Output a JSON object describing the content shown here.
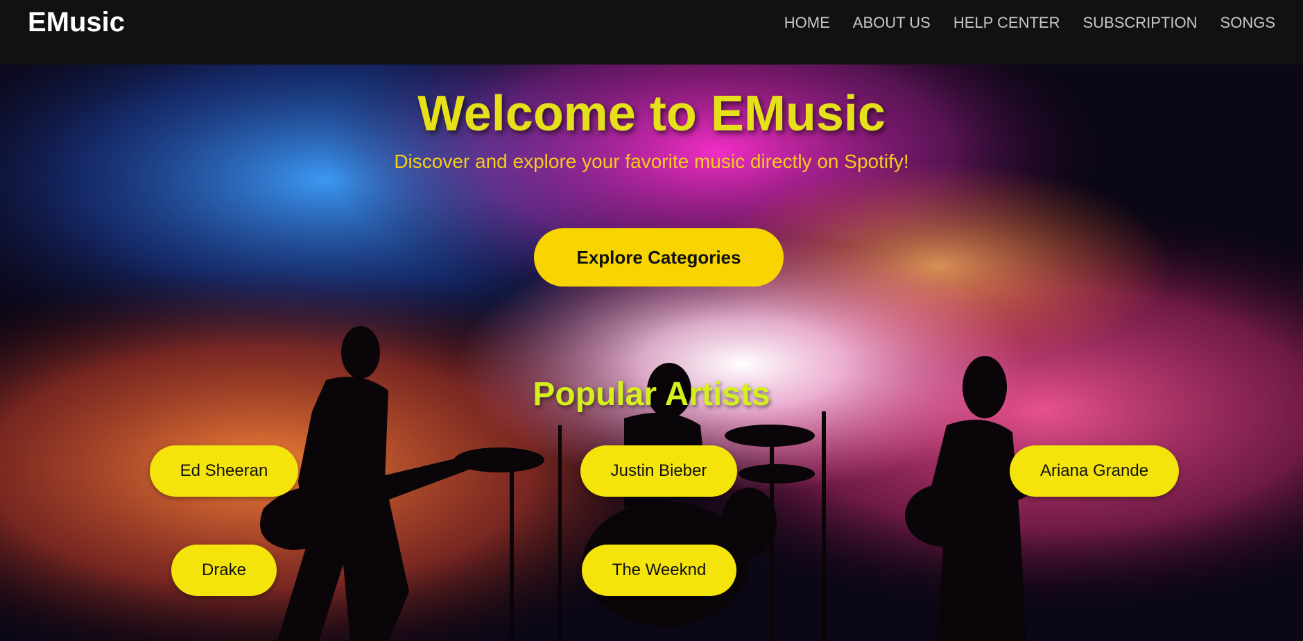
{
  "brand": "EMusic",
  "nav": {
    "items": [
      "HOME",
      "ABOUT US",
      "HELP CENTER",
      "SUBSCRIPTION",
      "SONGS"
    ]
  },
  "hero": {
    "title": "Welcome to EMusic",
    "subtitle": "Discover and explore your favorite music directly on Spotify!",
    "cta_label": "Explore Categories"
  },
  "artists_section": {
    "title": "Popular Artists",
    "artists": [
      "Ed Sheeran",
      "Justin Bieber",
      "Ariana Grande",
      "Drake",
      "The Weeknd"
    ]
  },
  "colors": {
    "navbar": "#111111",
    "title_yellow": "#e6e01a",
    "button_yellow": "#f8d500",
    "artist_pill": "#f5e40c"
  }
}
